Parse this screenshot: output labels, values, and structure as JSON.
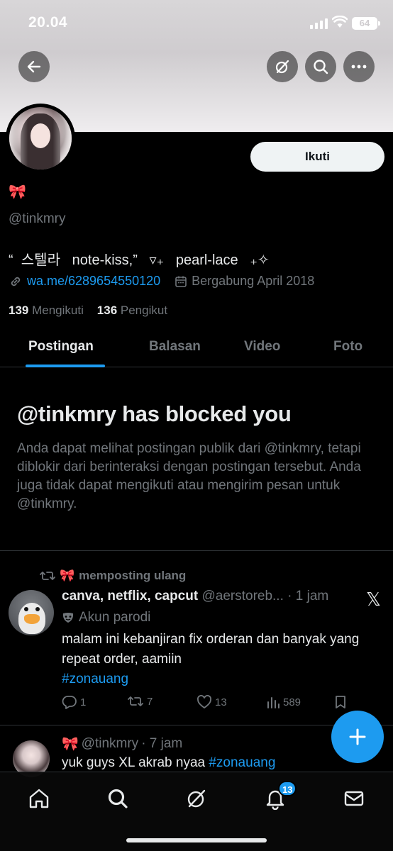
{
  "status_bar": {
    "time": "20.04",
    "battery": "64"
  },
  "profile": {
    "name_emoji": "🎀",
    "handle": "@tinkmry",
    "bio": "“  스텔라   note-kiss,”   ▿₊   pearl-lace   ₊✧",
    "link": "wa.me/6289654550120",
    "joined": "Bergabung April 2018",
    "following_count": "139",
    "following_label": "Mengikuti",
    "followers_count": "136",
    "followers_label": "Pengikut",
    "follow_button": "Ikuti"
  },
  "tabs": [
    {
      "label": "Postingan",
      "active": true
    },
    {
      "label": "Balasan",
      "active": false
    },
    {
      "label": "Video",
      "active": false
    },
    {
      "label": "Foto",
      "active": false
    }
  ],
  "blocked": {
    "title": "@tinkmry has blocked you",
    "description": "Anda dapat melihat postingan publik dari @tinkmry, tetapi diblokir dari berinteraksi dengan postingan tersebut. Anda juga tidak dapat mengikuti atau mengirim pesan untuk @tinkmry."
  },
  "tweets": [
    {
      "repost_label": "memposting ulang",
      "name": "canva, netflix, capcut",
      "handle": "@aerstoreb...",
      "time": "· 1 jam",
      "parody_label": "Akun parodi",
      "text": "malam ini kebanjiran fix orderan dan banyak yang repeat order, aamiin",
      "hashtag": "#zonauang",
      "replies": "1",
      "retweets": "7",
      "likes": "13",
      "views": "589"
    },
    {
      "handle": "@tinkmry",
      "time": "· 7 jam",
      "text": "yuk guys XL akrab nyaa ",
      "hashtag": "#zonauang"
    }
  ],
  "nav": {
    "notifications_badge": "13"
  },
  "colors": {
    "accent": "#1d9bf0",
    "muted": "#71767b",
    "text": "#e7e9ea",
    "background": "#000000"
  }
}
